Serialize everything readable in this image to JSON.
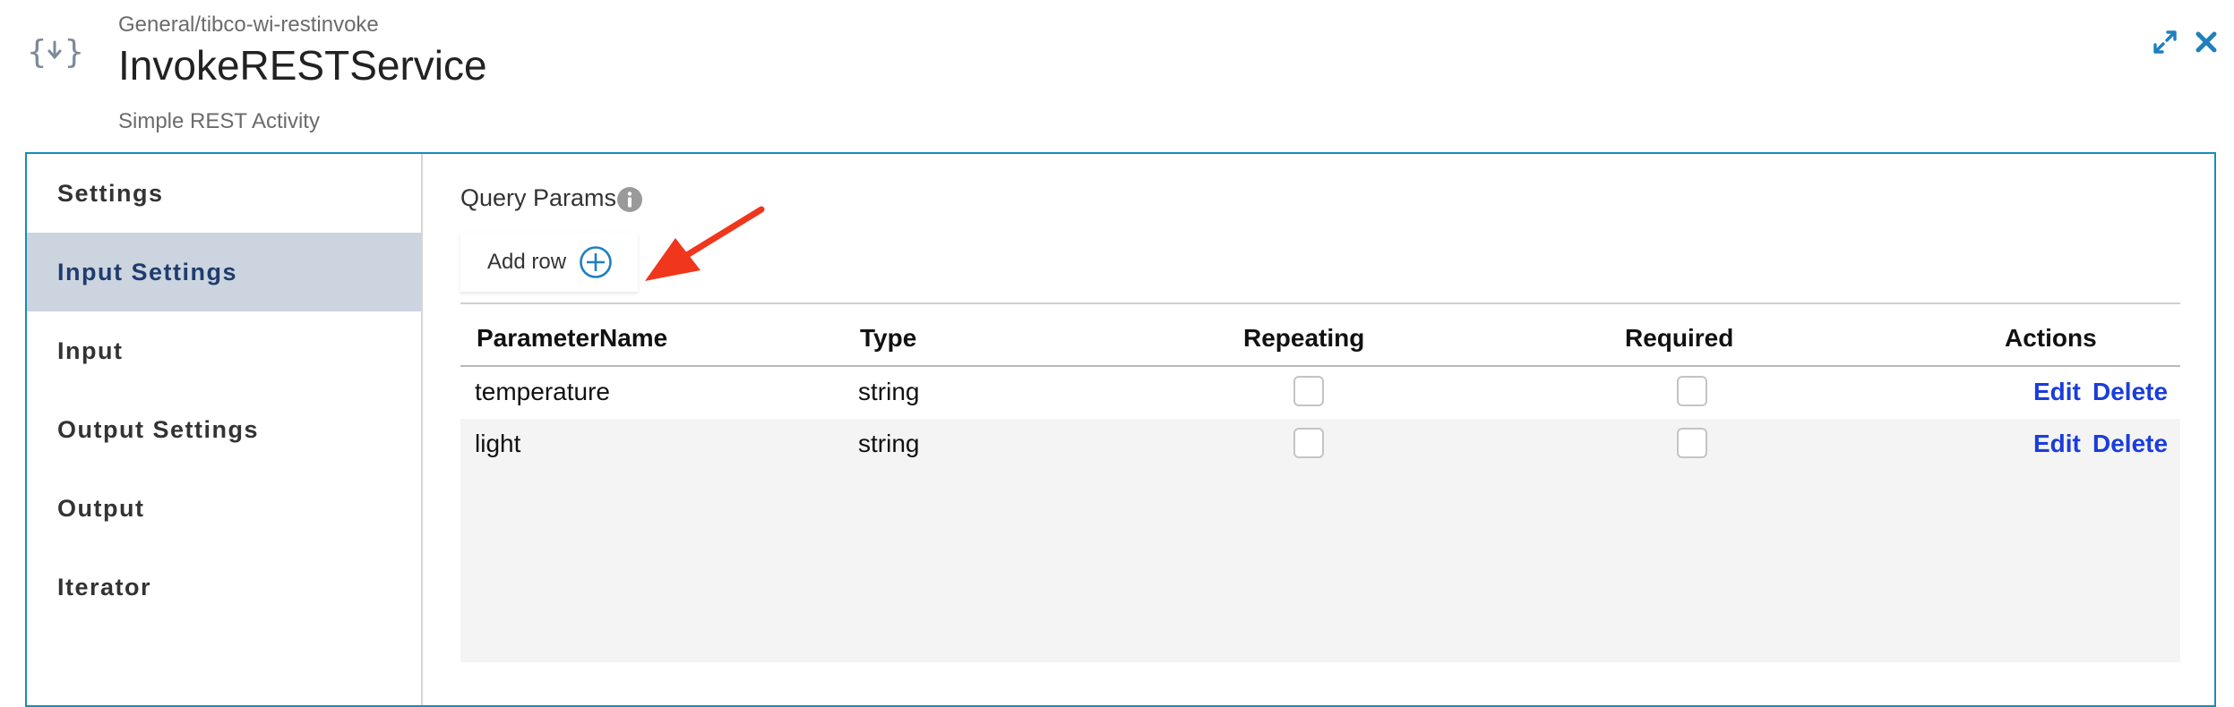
{
  "header": {
    "path": "General/tibco-wi-restinvoke",
    "title": "InvokeRESTService",
    "description": "Simple REST Activity",
    "logo_icon": "curly-braces-download-icon",
    "expand_icon": "expand-icon",
    "close_icon": "close-icon"
  },
  "sidebar": {
    "items": [
      {
        "label": "Settings",
        "active": false
      },
      {
        "label": "Input Settings",
        "active": true
      },
      {
        "label": "Input",
        "active": false
      },
      {
        "label": "Output Settings",
        "active": false
      },
      {
        "label": "Output",
        "active": false
      },
      {
        "label": "Iterator",
        "active": false
      }
    ]
  },
  "query_params": {
    "label": "Query Params",
    "info_icon": "info-icon",
    "add_row_label": "Add row",
    "add_icon": "plus-circle-icon"
  },
  "table": {
    "columns": [
      "ParameterName",
      "Type",
      "Repeating",
      "Required",
      "Actions"
    ],
    "rows": [
      {
        "name": "temperature",
        "type": "string",
        "repeating": false,
        "required": false,
        "edit": "Edit",
        "delete": "Delete"
      },
      {
        "name": "light",
        "type": "string",
        "repeating": false,
        "required": false,
        "edit": "Edit",
        "delete": "Delete"
      }
    ]
  },
  "colors": {
    "accent_border": "#1a8bb8",
    "active_sidebar_bg": "#ccd4df",
    "link": "#1a3ddb",
    "annotation_arrow": "#f0361c"
  }
}
